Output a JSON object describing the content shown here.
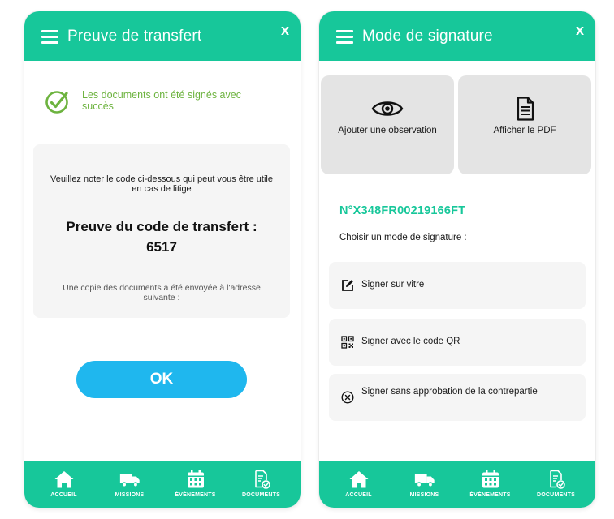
{
  "colors": {
    "primary": "#17c79a",
    "success_text": "#6db33f",
    "button_blue": "#1fb7ee",
    "card_bg": "#f5f5f5",
    "tile_bg": "#e4e4e4"
  },
  "left_screen": {
    "header": {
      "title": "Preuve de transfert",
      "close_label": "x",
      "menu_icon": "hamburger-icon"
    },
    "success": {
      "icon": "check-circle-icon",
      "message": "Les documents ont été signés avec succès"
    },
    "card": {
      "note": "Veuillez noter le code ci-dessous qui peut vous être utile en cas de litige",
      "heading": "Preuve du code de transfert :",
      "code": "6517",
      "copy_notice": "Une copie des documents a été envoyée à l'adresse suivante :"
    },
    "ok_button": "OK"
  },
  "right_screen": {
    "header": {
      "title": "Mode de signature",
      "close_label": "x",
      "menu_icon": "hamburger-icon"
    },
    "actions": [
      {
        "label": "Ajouter une observation",
        "icon": "eye-icon"
      },
      {
        "label": "Afficher le PDF",
        "icon": "document-icon"
      }
    ],
    "document_number": "N°X348FR00219166FT",
    "choose_label": "Choisir un mode de signature :",
    "options": [
      {
        "label": "Signer sur vitre",
        "icon": "edit-icon"
      },
      {
        "label": "Signer avec le code QR",
        "icon": "qr-code-icon"
      },
      {
        "label": "Signer sans approbation de la contrepartie",
        "icon": "cancel-circle-icon"
      }
    ]
  },
  "nav": {
    "items": [
      {
        "label": "ACCUEIL",
        "icon": "home-icon"
      },
      {
        "label": "MISSIONS",
        "icon": "truck-icon"
      },
      {
        "label": "ÉVÉNEMENTS",
        "icon": "calendar-icon"
      },
      {
        "label": "DOCUMENTS",
        "icon": "documents-icon"
      }
    ]
  }
}
